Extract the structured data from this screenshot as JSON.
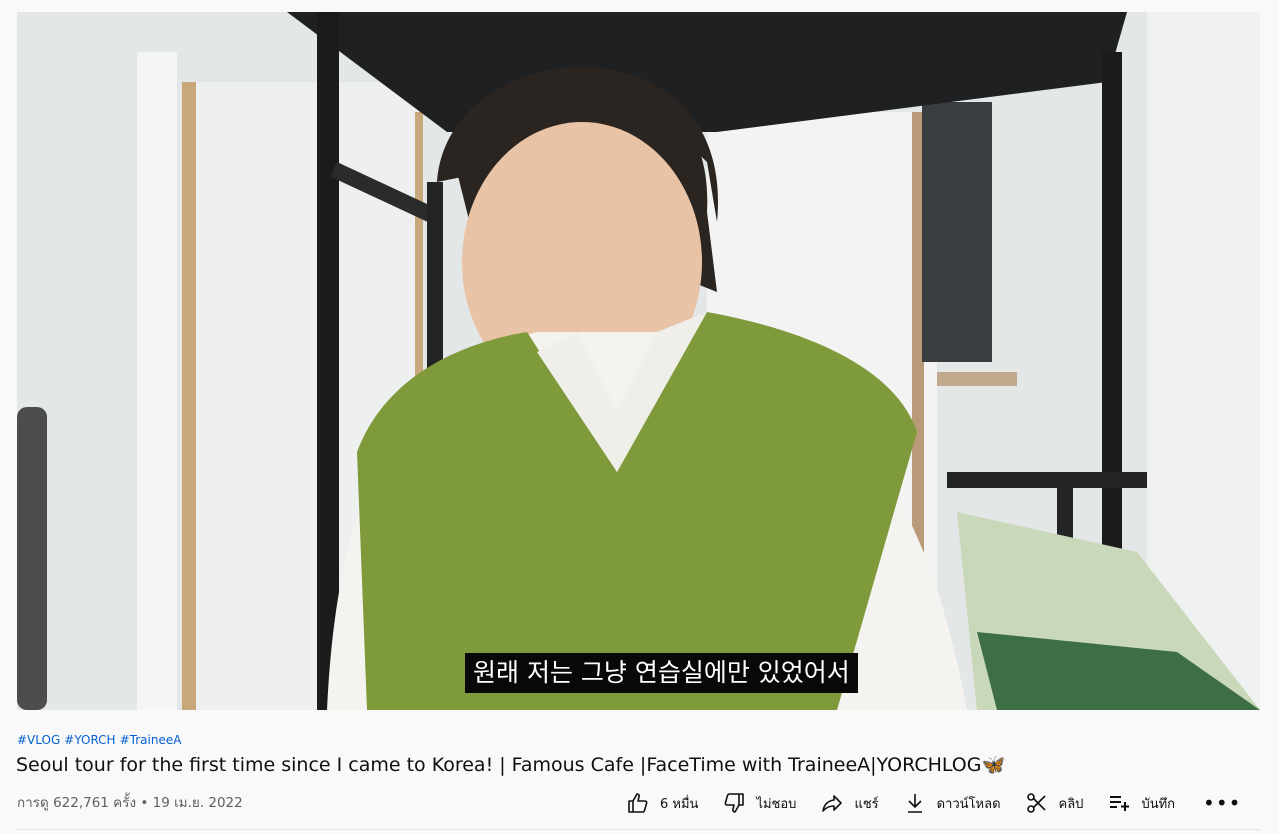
{
  "video": {
    "subtitle": "원래 저는 그냥 연습실에만 있었어서"
  },
  "hashtags": [
    "#VLOG",
    "#YORCH",
    "#TraineeA"
  ],
  "title": "Seoul tour for the first time since I came to Korea! | Famous Cafe |FaceTime with TraineeA|YORCHLOG🦋",
  "meta": "การดู 622,761 ครั้ง • 19 เม.ย. 2022",
  "actions": {
    "like": "6 หมื่น",
    "dislike": "ไม่ชอบ",
    "share": "แชร์",
    "download": "ดาวน์โหลด",
    "clip": "คลิป",
    "save": "บันทึก",
    "more": "•••"
  },
  "colors": {
    "hashtag": "#065fd4",
    "vest": "#7e9a3b"
  }
}
